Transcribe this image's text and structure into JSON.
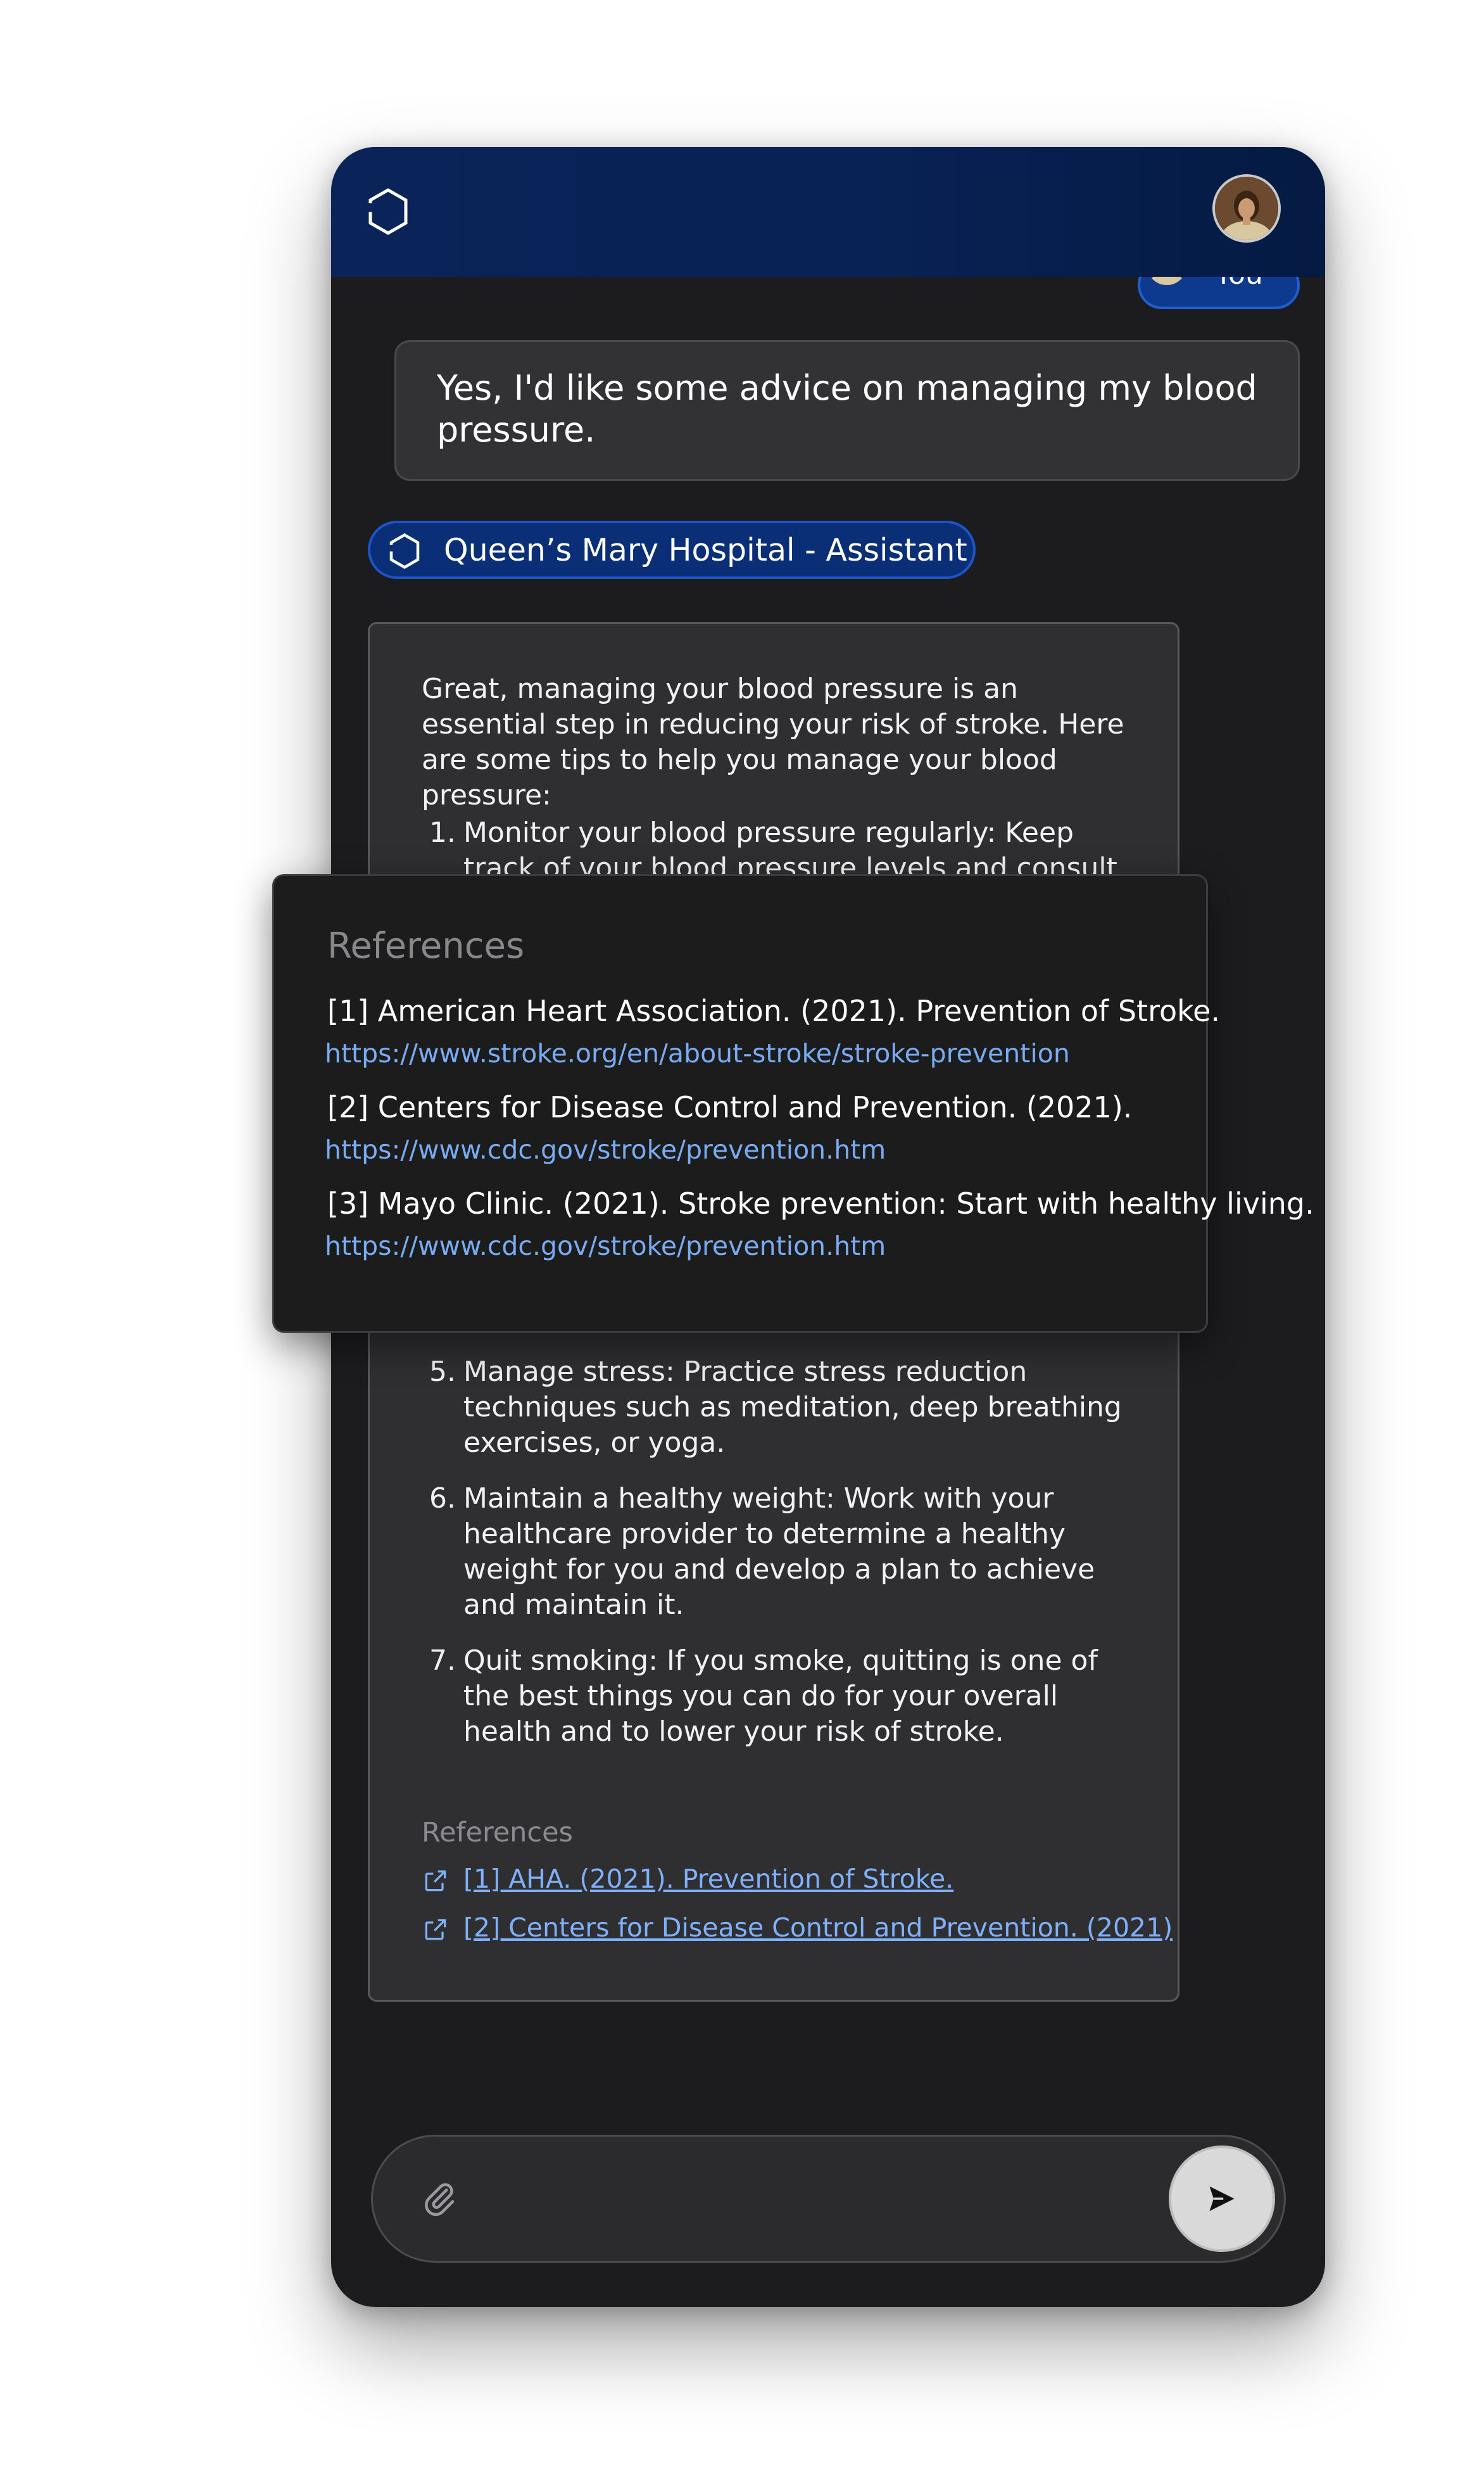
{
  "header": {
    "logo_icon": "hexagon-logo-icon",
    "avatar": "user-avatar"
  },
  "conversation": {
    "user_label": "You",
    "user_message": "Yes, I'd like some advice on managing my blood pressure.",
    "assistant_label": "Queen’s Mary Hospital - Assistant",
    "assistant_intro": "Great, managing your blood pressure is an essential step in reducing your risk of stroke. Here are some tips to help you manage your blood pressure:",
    "tips": [
      {
        "num": "1.",
        "text": "Monitor your blood pressure regularly: Keep track of your blood pressure levels and consult with"
      },
      {
        "num": "5.",
        "text": "Manage stress: Practice stress reduction techniques such as meditation, deep breathing exercises, or yoga."
      },
      {
        "num": "6.",
        "text": "Maintain a healthy weight: Work with your healthcare provider to determine a healthy weight for you and develop a plan to achieve and maintain it."
      },
      {
        "num": "7.",
        "text": "Quit smoking: If you smoke, quitting is one of the best things you can do for your overall health and to lower your risk of stroke."
      }
    ],
    "card_references_title": "References",
    "card_references": [
      "[1] AHA. (2021). Prevention of Stroke.",
      "[2] Centers for Disease Control and Prevention. (2021)"
    ]
  },
  "references_popover": {
    "title": "References",
    "items": [
      {
        "text": "[1] American Heart Association. (2021). Prevention of Stroke.",
        "url": "https://www.stroke.org/en/about-stroke/stroke-prevention"
      },
      {
        "text": "[2] Centers for Disease Control and Prevention. (2021).",
        "url": "https://www.cdc.gov/stroke/prevention.htm"
      },
      {
        "text": "[3] Mayo Clinic. (2021). Stroke prevention: Start with healthy living.",
        "url": "https://www.cdc.gov/stroke/prevention.htm"
      }
    ]
  },
  "composer": {
    "attach_icon": "paperclip-icon",
    "send_icon": "send-arrow-icon",
    "accent": "#1b55c8"
  }
}
